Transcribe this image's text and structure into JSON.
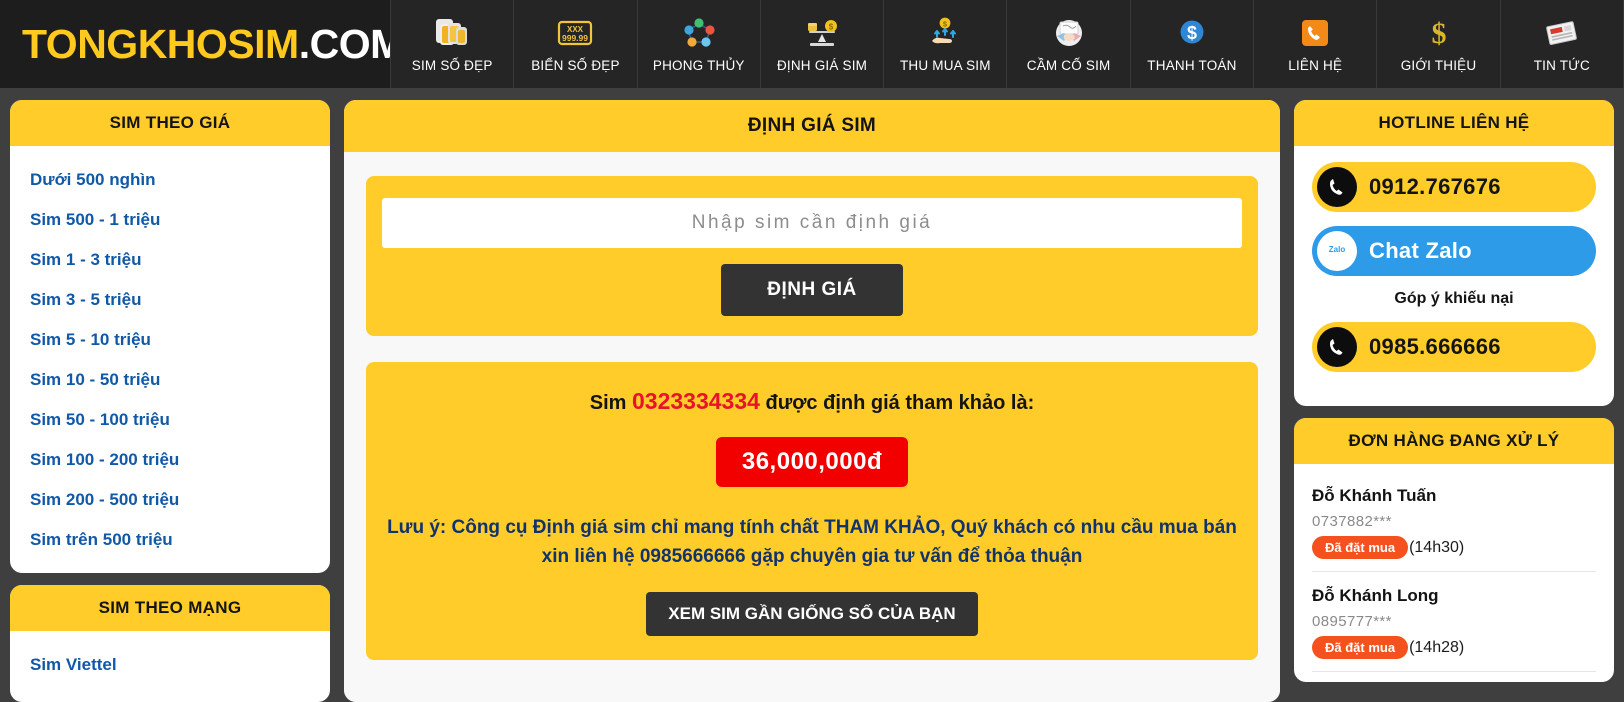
{
  "brand": {
    "name": "TONGKHOSIM",
    "suffix": ".COM"
  },
  "nav": [
    {
      "label": "SIM SỐ ĐẸP",
      "icon": "sim-cards-icon"
    },
    {
      "label": "BIỂN SỐ ĐẸP",
      "icon": "license-plate-icon"
    },
    {
      "label": "PHONG THỦY",
      "icon": "feng-shui-network-icon"
    },
    {
      "label": "ĐỊNH GIÁ SIM",
      "icon": "balance-scale-icon"
    },
    {
      "label": "THU MUA SIM",
      "icon": "hand-coin-icon"
    },
    {
      "label": "CẦM CỐ SIM",
      "icon": "handshake-icon"
    },
    {
      "label": "THANH TOÁN",
      "icon": "dollar-circle-icon"
    },
    {
      "label": "LIÊN HỆ",
      "icon": "phone-icon"
    },
    {
      "label": "GIỚI THIỆU",
      "icon": "dollar-sign-icon"
    },
    {
      "label": "TIN TỨC",
      "icon": "newspaper-icon"
    }
  ],
  "sidebar_price": {
    "title": "SIM THEO GIÁ",
    "items": [
      {
        "label": "Dưới 500 nghìn"
      },
      {
        "label": "Sim 500 - 1 triệu"
      },
      {
        "label": "Sim 1 - 3 triệu"
      },
      {
        "label": "Sim 3 - 5 triệu"
      },
      {
        "label": "Sim 5 - 10 triệu"
      },
      {
        "label": "Sim 10 - 50 triệu"
      },
      {
        "label": "Sim 50 - 100 triệu"
      },
      {
        "label": "Sim 100 - 200 triệu"
      },
      {
        "label": "Sim 200 - 500 triệu"
      },
      {
        "label": "Sim trên 500 triệu"
      }
    ]
  },
  "sidebar_network": {
    "title": "SIM THEO MẠNG",
    "items": [
      {
        "label": "Sim Viettel"
      }
    ]
  },
  "main": {
    "title": "ĐỊNH GIÁ SIM",
    "search": {
      "placeholder": "Nhập sim cần định giá",
      "value": "",
      "submit_label": "ĐỊNH GIÁ"
    },
    "result": {
      "prefix": "Sim",
      "sim_number": "0323334334",
      "suffix": "được định giá tham khảo là:",
      "price": "36,000,000đ",
      "note": "Lưu ý: Công cụ Định giá sim chỉ mang tính chất THAM KHẢO, Quý khách có nhu cầu mua bán xin liên hệ 0985666666 gặp chuyên gia tư vấn để thỏa thuận",
      "similar_button": "XEM SIM GẦN GIỐNG SỐ CỦA BẠN"
    }
  },
  "hotline": {
    "title": "HOTLINE LIÊN HỆ",
    "primary_phone": "0912.767676",
    "zalo_label": "Chat Zalo",
    "zalo_icon_text": "Zalo",
    "complaint_label": "Góp ý khiếu nại",
    "complaint_phone": "0985.666666"
  },
  "orders": {
    "title": "ĐƠN HÀNG ĐANG XỬ LÝ",
    "items": [
      {
        "name": "Đỗ Khánh Tuấn",
        "phone": "0737882***",
        "status": "Đã đặt mua",
        "time": "(14h30)"
      },
      {
        "name": "Đỗ Khánh Long",
        "phone": "0895777***",
        "status": "Đã đặt mua",
        "time": "(14h28)"
      }
    ]
  },
  "colors": {
    "yellow": "#FFCC2A",
    "dark_bg": "#3f3f3f",
    "header_bg": "#1d1d1d",
    "link_blue": "#1159A6",
    "red": "#F20000",
    "note_blue": "#12326B",
    "orange": "#F4511E",
    "zalo_blue": "#2E9BE8"
  }
}
